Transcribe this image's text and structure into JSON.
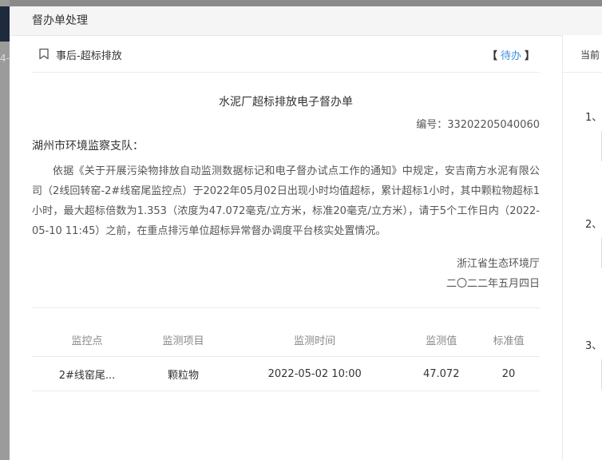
{
  "background": {
    "fragment": "4-"
  },
  "modal": {
    "title": "督办单处理",
    "doc_type": "事后-超标排放",
    "status_open": "【",
    "status": "待办",
    "status_close": "】",
    "doc_title": "水泥厂超标排放电子督办单",
    "doc_no": "编号：33202205040060",
    "recipient": "湖州市环境监察支队：",
    "body": "依据《关于开展污染物排放自动监测数据标记和电子督办试点工作的通知》中规定，安吉南方水泥有限公司（2线回转窑-2#线窑尾监控点）于2022年05月02日出现小时均值超标，累计超标1小时，其中颗粒物超标1小时，最大超标倍数为1.353（浓度为47.072毫克/立方米，标准20毫克/立方米），请于5个工作日内（2022-05-10 11:45）之前，在重点排污单位超标异常督办调度平台核实处置情况。",
    "issuer": "浙江省生态环境厅",
    "date": "二〇二二年五月四日",
    "table": {
      "headers": [
        "监控点",
        "监测项目",
        "监测时间",
        "监测值",
        "标准值"
      ],
      "rows": [
        [
          "2#线窑尾...",
          "颗粒物",
          "2022-05-02 10:00",
          "47.072",
          "20"
        ]
      ]
    }
  },
  "right_panel": {
    "title": "当前",
    "steps": [
      "1、",
      "2、",
      "3、"
    ]
  },
  "colors": {
    "accent": "#3d8fe0"
  },
  "icons": {
    "doc_type": "bookmark-icon"
  }
}
